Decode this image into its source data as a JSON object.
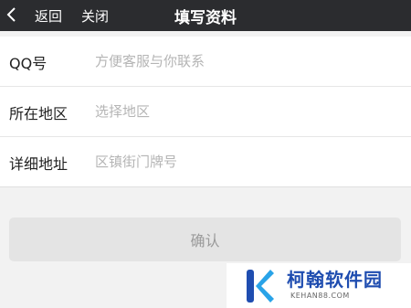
{
  "nav": {
    "back_label": "返回",
    "close_label": "关闭",
    "title": "填写资料"
  },
  "form": {
    "fields": [
      {
        "label": "QQ号",
        "placeholder": "方便客服与你联系",
        "value": ""
      },
      {
        "label": "所在地区",
        "placeholder": "选择地区",
        "value": ""
      },
      {
        "label": "详细地址",
        "placeholder": "区镇街门牌号",
        "value": ""
      }
    ]
  },
  "confirm_label": "确认",
  "watermark": {
    "brand": "柯翰软件园",
    "domain": "KEHAN88.COM"
  },
  "colors": {
    "nav_bg": "#2b2c2f",
    "page_bg": "#f2f2f2",
    "button_bg": "#e4e4e4",
    "brand_blue": "#1f4db0"
  }
}
